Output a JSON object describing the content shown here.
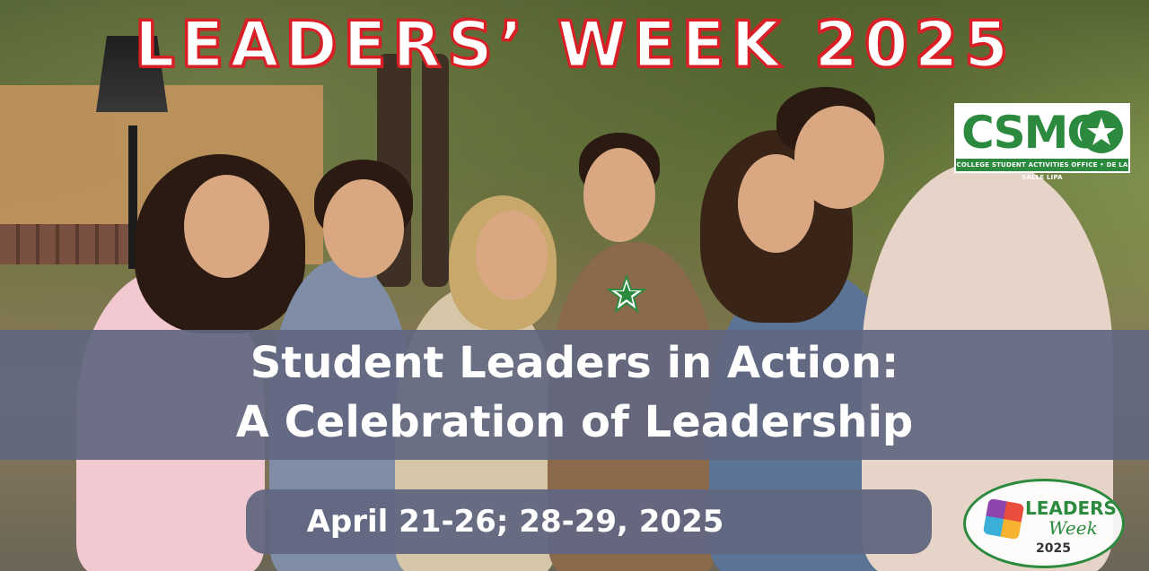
{
  "banner": {
    "title": "LEADERS’ WEEK 2025",
    "headline_line1": "Student Leaders in Action:",
    "headline_line2": "A Celebration of Leadership",
    "dates": "April 21-26; 28-29, 2025"
  },
  "logo": {
    "name": "CSMO",
    "subtitle": "COLLEGE STUDENT ACTIVITIES OFFICE • DE LA SALLE LIPA",
    "icon": "star-icon"
  },
  "badge": {
    "line1": "LEADERS",
    "line2": "Week",
    "line3": "2025"
  },
  "colors": {
    "title_outline": "#d81f26",
    "band": "#626780",
    "logo_green": "#2b8a3e"
  }
}
